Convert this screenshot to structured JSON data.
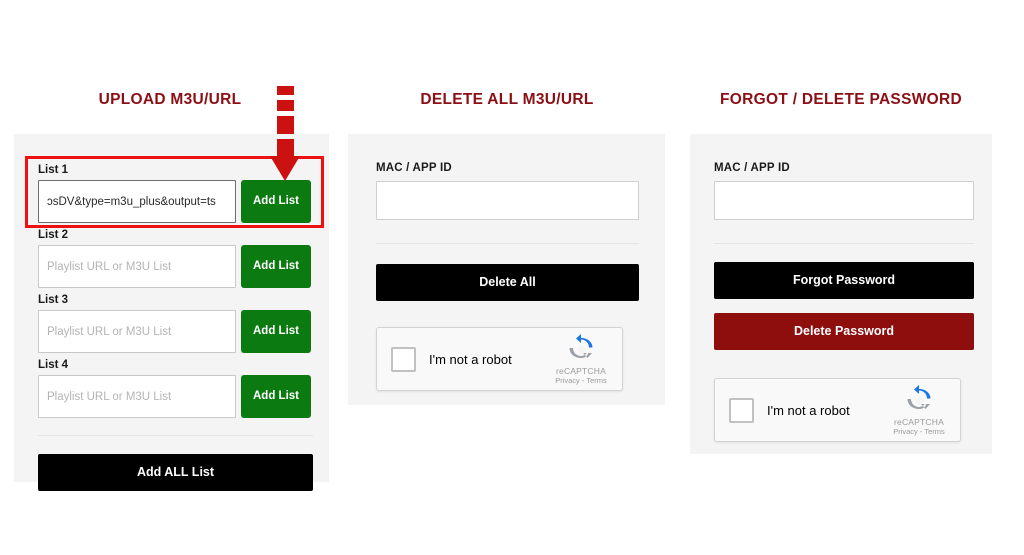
{
  "columns": {
    "upload": {
      "heading": "UPLOAD M3U/URL",
      "lists": [
        {
          "label": "List 1",
          "value": "ɔsDV&type=m3u_plus&output=ts",
          "placeholder": "Playlist URL or M3U List",
          "button": "Add List",
          "focused": true
        },
        {
          "label": "List 2",
          "value": "",
          "placeholder": "Playlist URL or M3U List",
          "button": "Add List",
          "focused": false
        },
        {
          "label": "List 3",
          "value": "",
          "placeholder": "Playlist URL or M3U List",
          "button": "Add List",
          "focused": false
        },
        {
          "label": "List 4",
          "value": "",
          "placeholder": "Playlist URL or M3U List",
          "button": "Add List",
          "focused": false
        }
      ],
      "add_all_button": "Add ALL List"
    },
    "delete": {
      "heading": "DELETE ALL M3U/URL",
      "field_label": "MAC / APP ID",
      "field_value": "",
      "field_placeholder": "",
      "delete_all_button": "Delete All",
      "recaptcha": {
        "label": "I'm not a robot",
        "brand": "reCAPTCHA",
        "terms": "Privacy - Terms"
      }
    },
    "forgot": {
      "heading": "FORGOT / DELETE PASSWORD",
      "field_label": "MAC / APP ID",
      "field_value": "",
      "field_placeholder": "",
      "forgot_password_button": "Forgot Password",
      "delete_password_button": "Delete Password",
      "recaptcha": {
        "label": "I'm not a robot",
        "brand": "reCAPTCHA",
        "terms": "Privacy - Terms"
      }
    }
  },
  "annotations": {
    "highlight_color": "#ee1111",
    "arrow_color": "#cc1111",
    "arrow_direction": "down"
  },
  "colors": {
    "heading": "#8b0f14",
    "green_button": "#0b7b11",
    "black_button": "#000000",
    "dark_red_button": "#8e0d0d",
    "card_background": "#f4f4f4",
    "page_background": "#ffffff"
  }
}
